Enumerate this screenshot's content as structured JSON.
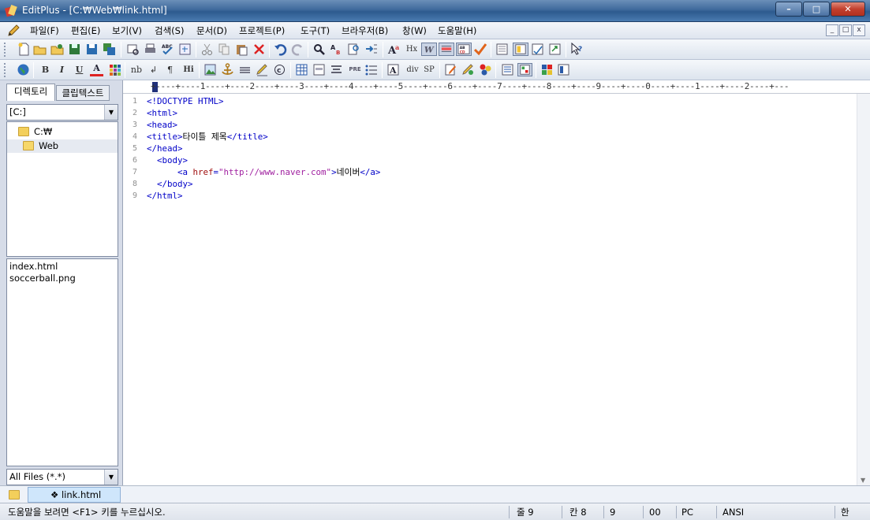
{
  "window": {
    "title": "EditPlus - [C:₩Web₩link.html]",
    "minimize": "–",
    "maximize": "□",
    "close": "✕"
  },
  "menu": [
    "파일(F)",
    "편집(E)",
    "보기(V)",
    "검색(S)",
    "문서(D)",
    "프로젝트(P)",
    "도구(T)",
    "브라우저(B)",
    "창(W)",
    "도움말(H)"
  ],
  "mdi_buttons": [
    "_",
    "□",
    "x"
  ],
  "toolbar2_text": {
    "bold": "B",
    "italic": "I",
    "underline": "U",
    "font_color": "A",
    "nbsp": "nb",
    "br": "↲",
    "para": "¶",
    "heading": "Hi",
    "pre": "PRE",
    "div": "div",
    "span": "SP",
    "hx": "Hx"
  },
  "left_panel": {
    "tabs": [
      "디렉토리",
      "클립텍스트"
    ],
    "drive": "[C:]",
    "tree": [
      "C:₩",
      "Web"
    ],
    "files": [
      "index.html",
      "soccerball.png"
    ],
    "filter": "All Files (*.*)"
  },
  "editor": {
    "ruler": "+----+----1----+----2----+----3----+----4----+----5----+----6----+----7----+----8----+----9----+----0----+----1----+----2----+---",
    "line_numbers": [
      "1",
      "2",
      "3",
      "4",
      "5",
      "6",
      "7",
      "8",
      "9"
    ],
    "code": {
      "l1": "<!DOCTYPE HTML>",
      "l2": "<html>",
      "l3": "<head>",
      "l4a": "<title>",
      "l4b": "타이틀 제목",
      "l4c": "</title>",
      "l5": "</head>",
      "l6": "  <body>",
      "l7a": "      <a ",
      "l7b": "href",
      "l7c": "=",
      "l7d": "\"http://www.naver.com\"",
      "l7e": ">",
      "l7f": "네이버",
      "l7g": "</a>",
      "l8": "  </body>",
      "l9": "</html>"
    }
  },
  "document_tab": "❖ link.html",
  "status": {
    "help": "도움말을 보려면 <F1> 키를 누르십시오.",
    "line": "줄 9",
    "col": "칸 8",
    "total": "9",
    "mode": "00",
    "eol": "PC",
    "encoding": "ANSI",
    "ime": "한"
  }
}
